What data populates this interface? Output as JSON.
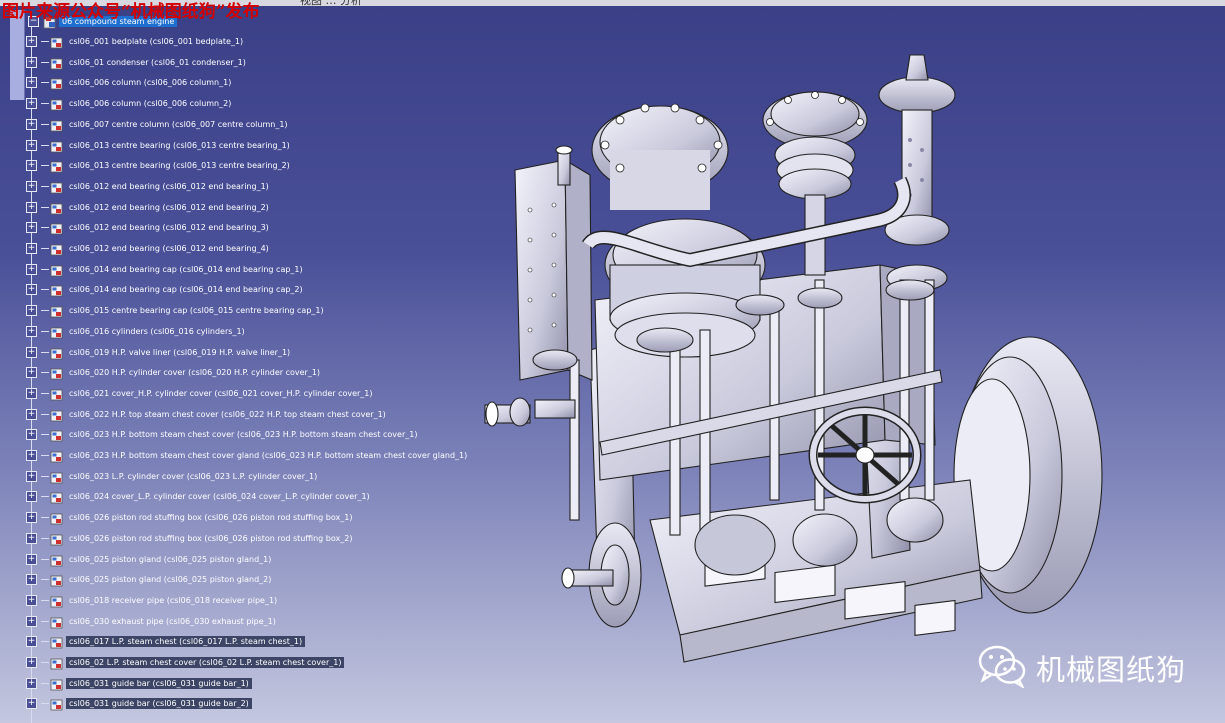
{
  "watermark": {
    "top_text": "图片来源公众号“机械图纸狗”发布"
  },
  "menu_fragment": "视图 …  分析",
  "tree": {
    "root": {
      "label": "06 compound steam engine",
      "icon": "assembly-icon"
    },
    "items": [
      "csl06_001 bedplate (csl06_001 bedplate_1)",
      "csl06_01 condenser (csl06_01 condenser_1)",
      "csl06_006 column (csl06_006 column_1)",
      "csl06_006 column (csl06_006 column_2)",
      "csl06_007 centre column (csl06_007 centre column_1)",
      "csl06_013 centre bearing (csl06_013 centre bearing_1)",
      "csl06_013 centre bearing (csl06_013 centre bearing_2)",
      "csl06_012 end bearing (csl06_012 end bearing_1)",
      "csl06_012 end bearing (csl06_012 end bearing_2)",
      "csl06_012 end bearing (csl06_012 end bearing_3)",
      "csl06_012 end bearing (csl06_012 end bearing_4)",
      "csl06_014 end bearing cap (csl06_014 end bearing cap_1)",
      "csl06_014 end bearing cap (csl06_014 end bearing cap_2)",
      "csl06_015 centre bearing cap (csl06_015 centre bearing cap_1)",
      "csl06_016 cylinders (csl06_016 cylinders_1)",
      "csl06_019 H.P. valve liner (csl06_019 H.P. valve liner_1)",
      "csl06_020 H.P. cylinder cover (csl06_020 H.P. cylinder cover_1)",
      "csl06_021 cover_H.P. cylinder cover (csl06_021 cover_H.P. cylinder cover_1)",
      "csl06_022 H.P. top steam chest cover (csl06_022 H.P. top steam chest cover_1)",
      "csl06_023 H.P. bottom steam chest cover (csl06_023 H.P. bottom steam chest cover_1)",
      "csl06_023 H.P. bottom steam chest cover gland (csl06_023 H.P. bottom steam chest cover gland_1)",
      "csl06_023 L.P. cylinder cover (csl06_023 L.P. cylinder cover_1)",
      "csl06_024 cover_L.P. cylinder cover (csl06_024 cover_L.P. cylinder cover_1)",
      "csl06_026 piston rod stuffing box (csl06_026 piston rod stuffing box_1)",
      "csl06_026 piston rod stuffing box (csl06_026 piston rod stuffing box_2)",
      "csl06_025 piston gland (csl06_025 piston gland_1)",
      "csl06_025 piston gland (csl06_025 piston gland_2)",
      "csl06_018 receiver pipe (csl06_018 receiver pipe_1)",
      "csl06_030 exhaust pipe (csl06_030 exhaust pipe_1)",
      "csl06_017 L.P. steam chest (csl06_017 L.P. steam chest_1)",
      "csl06_02 L.P. steam chest cover (csl06_02 L.P. steam chest cover_1)",
      "csl06_031 guide bar (csl06_031 guide bar_1)",
      "csl06_031 guide bar (csl06_031 guide bar_2)"
    ],
    "selected_from_index": 29,
    "item_icon": "part-icon",
    "expander_symbol": "+"
  },
  "viewport": {
    "model": "compound steam engine 3D model",
    "icon": "steam-engine-model"
  },
  "brand": {
    "text": "机械图纸狗",
    "icon": "wechat-icon"
  },
  "colors": {
    "background_top": "#3a3f86",
    "background_bottom": "#c4c7df",
    "root_highlight": "#1f6fd1",
    "selected_highlight": "#3d4566",
    "watermark_red": "#d40000"
  }
}
